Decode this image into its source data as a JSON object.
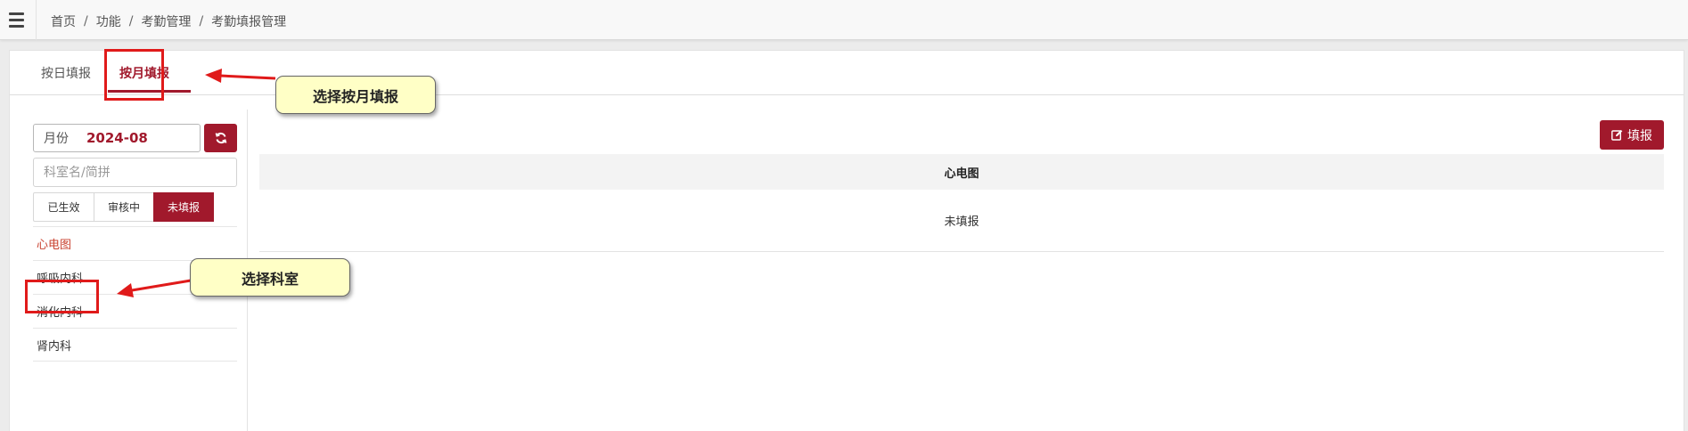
{
  "header": {
    "breadcrumb": [
      "首页",
      "功能",
      "考勤管理",
      "考勤填报管理"
    ],
    "separator": "/",
    "menu_icon": "hamburger-icon"
  },
  "tabs": [
    {
      "label": "按日填报",
      "active": false
    },
    {
      "label": "按月填报",
      "active": true
    }
  ],
  "sidebar": {
    "month_label": "月份",
    "month_value": "2024-08",
    "refresh_icon": "refresh-icon",
    "search_placeholder": "科室名/简拼",
    "filters": [
      {
        "label": "已生效",
        "active": false
      },
      {
        "label": "审核中",
        "active": false
      },
      {
        "label": "未填报",
        "active": true
      }
    ],
    "departments": [
      {
        "label": "心电图",
        "active": true
      },
      {
        "label": "呼吸内科",
        "active": false
      },
      {
        "label": "消化内科",
        "active": false
      },
      {
        "label": "肾内科",
        "active": false
      }
    ]
  },
  "content": {
    "fill_button": "填报",
    "fill_icon": "edit-icon",
    "table_header": "心电图",
    "table_cell": "未填报"
  },
  "annotations": {
    "tab_callout": "选择按月填报",
    "dept_callout": "选择科室"
  },
  "colors": {
    "accent": "#a1192c",
    "active_dept": "#c9422f",
    "highlight": "#e01a1a",
    "callout_bg": "#ffffc6"
  }
}
